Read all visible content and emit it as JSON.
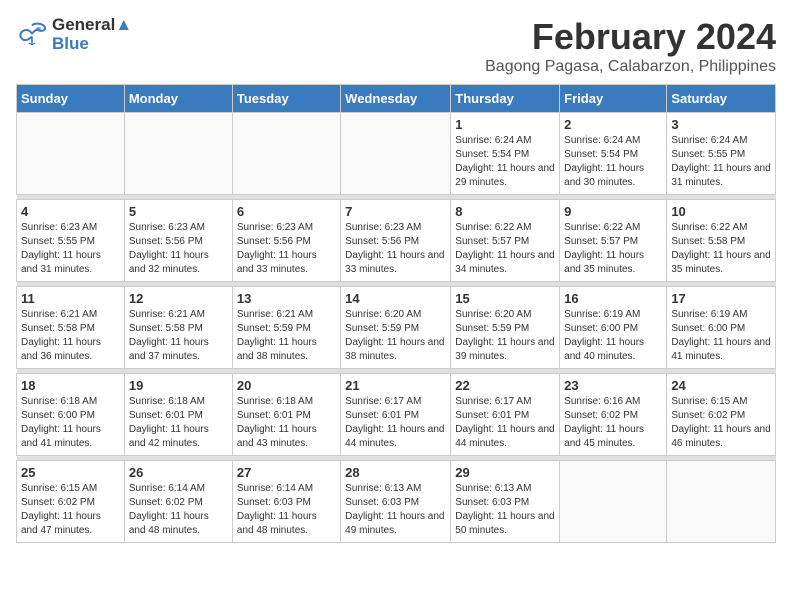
{
  "logo": {
    "line1": "General",
    "line2": "Blue"
  },
  "title": "February 2024",
  "subtitle": "Bagong Pagasa, Calabarzon, Philippines",
  "weekdays": [
    "Sunday",
    "Monday",
    "Tuesday",
    "Wednesday",
    "Thursday",
    "Friday",
    "Saturday"
  ],
  "weeks": [
    [
      {
        "day": "",
        "sunrise": "",
        "sunset": "",
        "daylight": ""
      },
      {
        "day": "",
        "sunrise": "",
        "sunset": "",
        "daylight": ""
      },
      {
        "day": "",
        "sunrise": "",
        "sunset": "",
        "daylight": ""
      },
      {
        "day": "",
        "sunrise": "",
        "sunset": "",
        "daylight": ""
      },
      {
        "day": "1",
        "sunrise": "6:24 AM",
        "sunset": "5:54 PM",
        "daylight": "11 hours and 29 minutes."
      },
      {
        "day": "2",
        "sunrise": "6:24 AM",
        "sunset": "5:54 PM",
        "daylight": "11 hours and 30 minutes."
      },
      {
        "day": "3",
        "sunrise": "6:24 AM",
        "sunset": "5:55 PM",
        "daylight": "11 hours and 31 minutes."
      }
    ],
    [
      {
        "day": "4",
        "sunrise": "6:23 AM",
        "sunset": "5:55 PM",
        "daylight": "11 hours and 31 minutes."
      },
      {
        "day": "5",
        "sunrise": "6:23 AM",
        "sunset": "5:56 PM",
        "daylight": "11 hours and 32 minutes."
      },
      {
        "day": "6",
        "sunrise": "6:23 AM",
        "sunset": "5:56 PM",
        "daylight": "11 hours and 33 minutes."
      },
      {
        "day": "7",
        "sunrise": "6:23 AM",
        "sunset": "5:56 PM",
        "daylight": "11 hours and 33 minutes."
      },
      {
        "day": "8",
        "sunrise": "6:22 AM",
        "sunset": "5:57 PM",
        "daylight": "11 hours and 34 minutes."
      },
      {
        "day": "9",
        "sunrise": "6:22 AM",
        "sunset": "5:57 PM",
        "daylight": "11 hours and 35 minutes."
      },
      {
        "day": "10",
        "sunrise": "6:22 AM",
        "sunset": "5:58 PM",
        "daylight": "11 hours and 35 minutes."
      }
    ],
    [
      {
        "day": "11",
        "sunrise": "6:21 AM",
        "sunset": "5:58 PM",
        "daylight": "11 hours and 36 minutes."
      },
      {
        "day": "12",
        "sunrise": "6:21 AM",
        "sunset": "5:58 PM",
        "daylight": "11 hours and 37 minutes."
      },
      {
        "day": "13",
        "sunrise": "6:21 AM",
        "sunset": "5:59 PM",
        "daylight": "11 hours and 38 minutes."
      },
      {
        "day": "14",
        "sunrise": "6:20 AM",
        "sunset": "5:59 PM",
        "daylight": "11 hours and 38 minutes."
      },
      {
        "day": "15",
        "sunrise": "6:20 AM",
        "sunset": "5:59 PM",
        "daylight": "11 hours and 39 minutes."
      },
      {
        "day": "16",
        "sunrise": "6:19 AM",
        "sunset": "6:00 PM",
        "daylight": "11 hours and 40 minutes."
      },
      {
        "day": "17",
        "sunrise": "6:19 AM",
        "sunset": "6:00 PM",
        "daylight": "11 hours and 41 minutes."
      }
    ],
    [
      {
        "day": "18",
        "sunrise": "6:18 AM",
        "sunset": "6:00 PM",
        "daylight": "11 hours and 41 minutes."
      },
      {
        "day": "19",
        "sunrise": "6:18 AM",
        "sunset": "6:01 PM",
        "daylight": "11 hours and 42 minutes."
      },
      {
        "day": "20",
        "sunrise": "6:18 AM",
        "sunset": "6:01 PM",
        "daylight": "11 hours and 43 minutes."
      },
      {
        "day": "21",
        "sunrise": "6:17 AM",
        "sunset": "6:01 PM",
        "daylight": "11 hours and 44 minutes."
      },
      {
        "day": "22",
        "sunrise": "6:17 AM",
        "sunset": "6:01 PM",
        "daylight": "11 hours and 44 minutes."
      },
      {
        "day": "23",
        "sunrise": "6:16 AM",
        "sunset": "6:02 PM",
        "daylight": "11 hours and 45 minutes."
      },
      {
        "day": "24",
        "sunrise": "6:15 AM",
        "sunset": "6:02 PM",
        "daylight": "11 hours and 46 minutes."
      }
    ],
    [
      {
        "day": "25",
        "sunrise": "6:15 AM",
        "sunset": "6:02 PM",
        "daylight": "11 hours and 47 minutes."
      },
      {
        "day": "26",
        "sunrise": "6:14 AM",
        "sunset": "6:02 PM",
        "daylight": "11 hours and 48 minutes."
      },
      {
        "day": "27",
        "sunrise": "6:14 AM",
        "sunset": "6:03 PM",
        "daylight": "11 hours and 48 minutes."
      },
      {
        "day": "28",
        "sunrise": "6:13 AM",
        "sunset": "6:03 PM",
        "daylight": "11 hours and 49 minutes."
      },
      {
        "day": "29",
        "sunrise": "6:13 AM",
        "sunset": "6:03 PM",
        "daylight": "11 hours and 50 minutes."
      },
      {
        "day": "",
        "sunrise": "",
        "sunset": "",
        "daylight": ""
      },
      {
        "day": "",
        "sunrise": "",
        "sunset": "",
        "daylight": ""
      }
    ]
  ]
}
